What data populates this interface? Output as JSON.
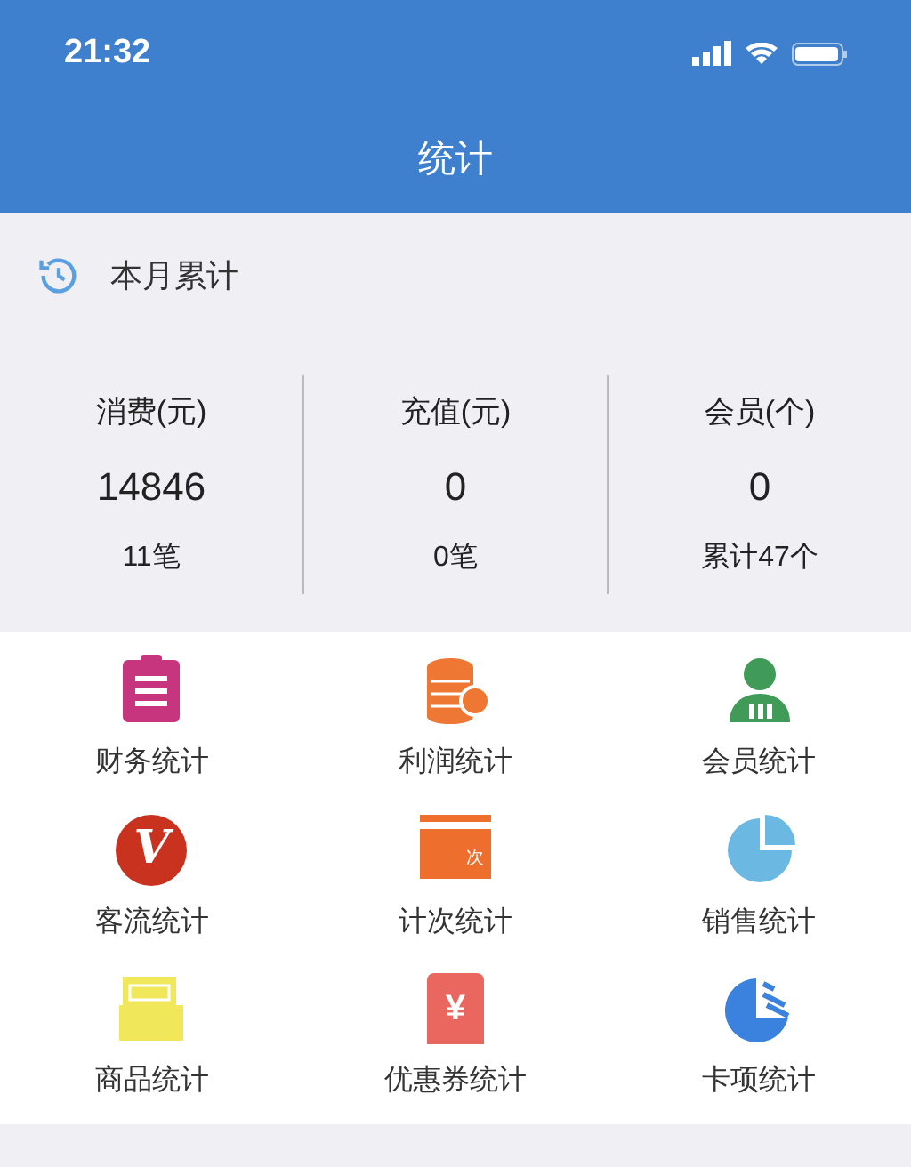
{
  "status_bar": {
    "time": "21:32"
  },
  "nav": {
    "title": "统计"
  },
  "summary": {
    "title": "本月累计",
    "stats": [
      {
        "label": "消费(元)",
        "value": "14846",
        "sub": "11笔"
      },
      {
        "label": "充值(元)",
        "value": "0",
        "sub": "0笔"
      },
      {
        "label": "会员(个)",
        "value": "0",
        "sub": "累计47个"
      }
    ]
  },
  "menu": [
    {
      "label": "财务统计",
      "kind": "clipboard",
      "color": "#c8357f"
    },
    {
      "label": "利润统计",
      "kind": "coins",
      "color": "#ee7733"
    },
    {
      "label": "会员统计",
      "kind": "member",
      "color": "#3f9b57"
    },
    {
      "label": "客流统计",
      "kind": "vbadge",
      "color": "#c9321f",
      "icon_text": "V"
    },
    {
      "label": "计次统计",
      "kind": "card",
      "color": "#ee6f2d",
      "icon_text": "次"
    },
    {
      "label": "销售统计",
      "kind": "pie",
      "color": "#6bb9e3"
    },
    {
      "label": "商品统计",
      "kind": "box",
      "color": "#f0e75a"
    },
    {
      "label": "优惠券统计",
      "kind": "coupon",
      "color": "#e9675f",
      "icon_text": "¥"
    },
    {
      "label": "卡项统计",
      "kind": "piechart",
      "color": "#3a82dd"
    }
  ]
}
